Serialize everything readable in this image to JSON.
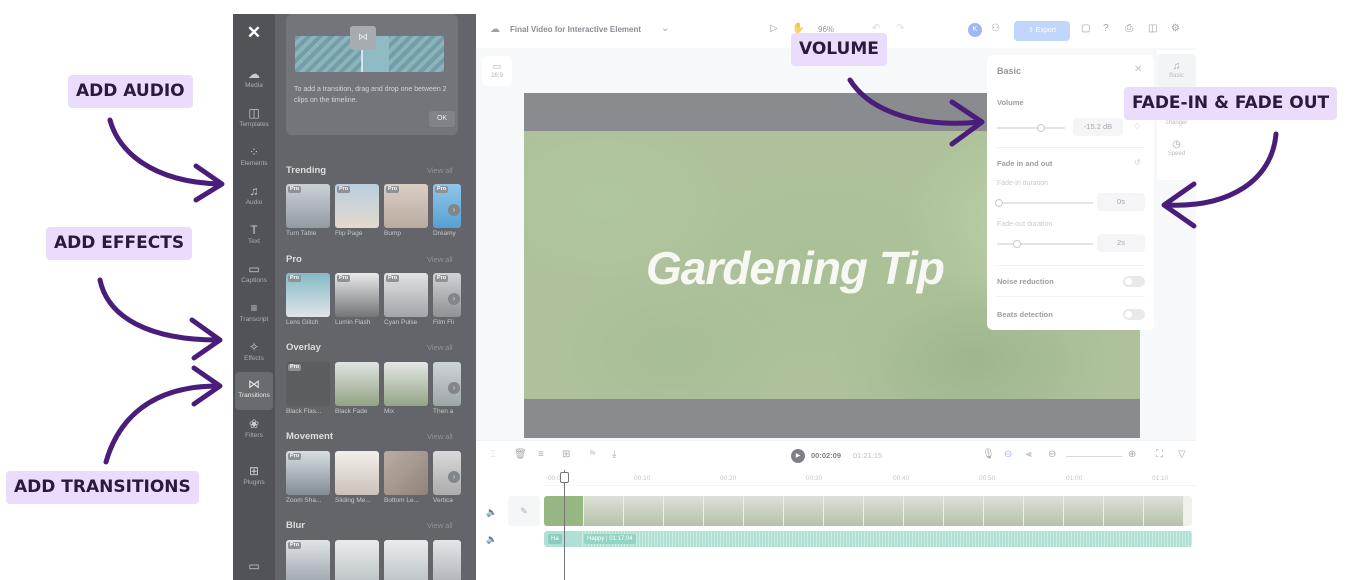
{
  "rail": {
    "items": [
      {
        "label": "Media",
        "icon": "☁"
      },
      {
        "label": "Templates",
        "icon": "◫"
      },
      {
        "label": "Elements",
        "icon": "⁘"
      },
      {
        "label": "Audio",
        "icon": "♫"
      },
      {
        "label": "Text",
        "icon": "T"
      },
      {
        "label": "Captions",
        "icon": "▭"
      },
      {
        "label": "Transcript",
        "icon": "≡"
      },
      {
        "label": "Effects",
        "icon": "✧"
      },
      {
        "label": "Transitions",
        "icon": "⋈"
      },
      {
        "label": "Filters",
        "icon": "❀"
      },
      {
        "label": "Plugins",
        "icon": "⊞"
      }
    ]
  },
  "panel": {
    "tip_text": "To add a transition, drag and drop one between 2 clips on the timeline.",
    "tip_ok": "OK",
    "view_all": "View all",
    "pro_badge": "Pro",
    "sections": [
      {
        "title": "Trending",
        "items": [
          "Turn Table",
          "Flip Page",
          "Bump",
          "Dreamy"
        ]
      },
      {
        "title": "Pro",
        "items": [
          "Lens Glitch",
          "Lumin Flash",
          "Cyan Pulse",
          "Film Fli"
        ]
      },
      {
        "title": "Overlay",
        "items": [
          "Black Flas...",
          "Black Fade",
          "Mix",
          "Then a"
        ]
      },
      {
        "title": "Movement",
        "items": [
          "Zoom Sha...",
          "Sliding Me...",
          "Bottom Le...",
          "Vertica"
        ]
      },
      {
        "title": "Blur",
        "items": []
      }
    ]
  },
  "topbar": {
    "project_title": "Final Video for Interactive Element",
    "zoom": "96%",
    "avatar_initial": "K",
    "export_label": "Export"
  },
  "canvas": {
    "ratio_label": "16:9",
    "video_title": "Gardening Tip"
  },
  "side_tabs": [
    {
      "label": "Basic",
      "icon": "♫"
    },
    {
      "label": "changer",
      "icon": ""
    },
    {
      "label": "Speed",
      "icon": "◷"
    }
  ],
  "basic_panel": {
    "title": "Basic",
    "volume_label": "Volume",
    "volume_value": "-15.2 dB",
    "fade_label": "Fade in and out",
    "fade_in_label": "Fade-in duration",
    "fade_in_value": "0s",
    "fade_out_label": "Fade-out duration",
    "fade_out_value": "2s",
    "noise_label": "Noise reduction",
    "beats_label": "Beats detection"
  },
  "timeline": {
    "current_time": "00:02:09",
    "total_time": "01:21:15",
    "ruler": [
      "00:00",
      "00:10",
      "00:20",
      "00:30",
      "00:40",
      "00:50",
      "01:00",
      "01:10"
    ],
    "audio_clip_name": "Happy",
    "audio_clip_duration": "01:17:04",
    "audio_tag": "Ha"
  },
  "callouts": {
    "add_audio": "ADD AUDIO",
    "add_effects": "ADD EFFECTS",
    "add_transitions": "ADD TRANSITIONS",
    "volume": "VOLUME",
    "fade": "FADE-IN & FADE OUT"
  },
  "colors": {
    "callout_bg": "#eadcfb",
    "arrow": "#4b1d7a",
    "export_button": "#a9c7fd",
    "audio_track": "#8fd6c3"
  }
}
